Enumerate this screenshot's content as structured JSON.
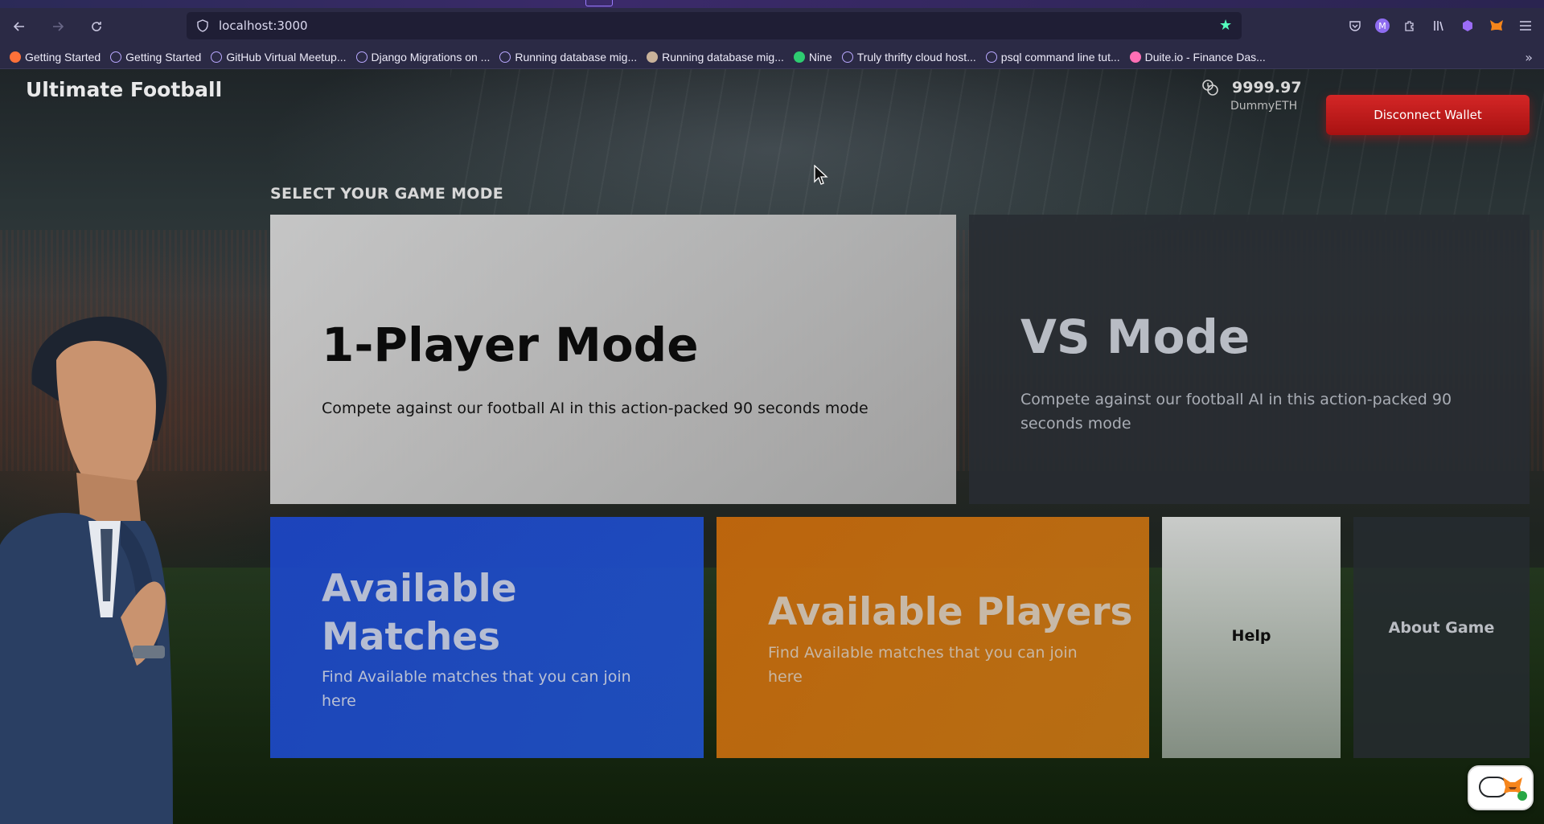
{
  "browser": {
    "url": "localhost:3000",
    "bookmarks": [
      {
        "label": "Getting Started",
        "icon": "firefox-icon",
        "color": "#ff7139"
      },
      {
        "label": "Getting Started",
        "icon": "globe-icon",
        "color": "#b9a8ff"
      },
      {
        "label": "GitHub Virtual Meetup...",
        "icon": "globe-icon",
        "color": "#b9a8ff"
      },
      {
        "label": "Django Migrations on ...",
        "icon": "globe-icon",
        "color": "#b9a8ff"
      },
      {
        "label": "Running database mig...",
        "icon": "globe-icon",
        "color": "#b9a8ff"
      },
      {
        "label": "Running database mig...",
        "icon": "avatar-icon",
        "color": "#c9b29a"
      },
      {
        "label": "Nine",
        "icon": "nine-icon",
        "color": "#2ecc71"
      },
      {
        "label": "Truly thrifty cloud host...",
        "icon": "globe-icon",
        "color": "#b9a8ff"
      },
      {
        "label": "psql command line tut...",
        "icon": "globe-icon",
        "color": "#b9a8ff"
      },
      {
        "label": "Duite.io - Finance Das...",
        "icon": "duite-icon",
        "color": "#ff6fb5"
      }
    ]
  },
  "app": {
    "brand": "Ultimate Football",
    "wallet": {
      "balance": "9999.97",
      "currency": "DummyETH"
    },
    "disconnect_label": "Disconnect Wallet",
    "section_title": "SELECT YOUR GAME MODE",
    "modes": {
      "one_player": {
        "title": "1-Player Mode",
        "desc": "Compete against our football AI in this action-packed 90 seconds mode"
      },
      "vs": {
        "title": "VS Mode",
        "desc": "Compete against our football AI in this action-packed 90 seconds mode"
      },
      "available_matches": {
        "title": "Available Matches",
        "desc": "Find Available matches that you can join here"
      },
      "available_players": {
        "title": "Available Players",
        "desc": "Find Available matches that you can join here"
      },
      "help": {
        "title": "Help"
      },
      "about": {
        "title": "About Game"
      }
    }
  },
  "colors": {
    "accent_red": "#c41d1d",
    "blue_card": "#1f4fc8",
    "orange_card": "#c46c10",
    "bookmark_star": "#54ffbd"
  }
}
